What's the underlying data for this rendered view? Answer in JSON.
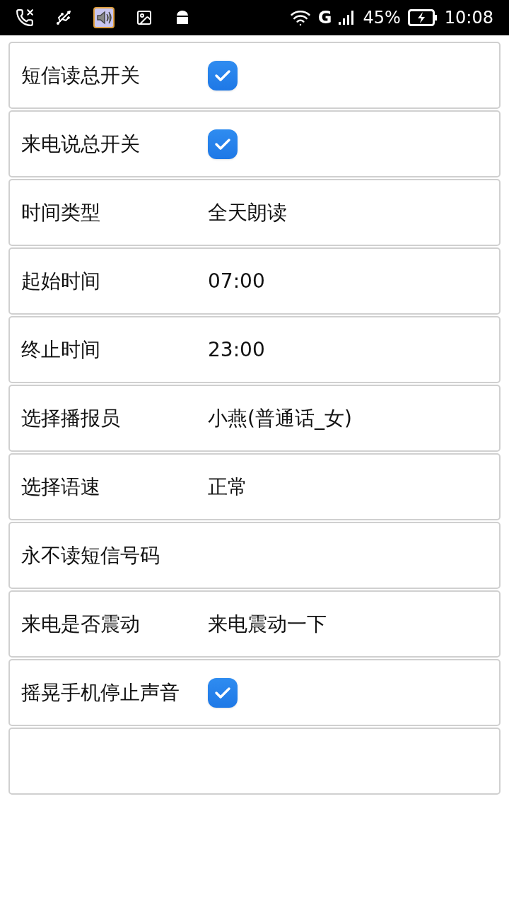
{
  "status_bar": {
    "network": "G",
    "battery": "45%",
    "time": "10:08"
  },
  "settings": [
    {
      "kind": "checkbox",
      "label": "短信读总开关",
      "checked": true
    },
    {
      "kind": "checkbox",
      "label": "来电说总开关",
      "checked": true
    },
    {
      "kind": "value",
      "label": "时间类型",
      "value": "全天朗读"
    },
    {
      "kind": "value",
      "label": "起始时间",
      "value": "07:00"
    },
    {
      "kind": "value",
      "label": "终止时间",
      "value": "23:00"
    },
    {
      "kind": "value",
      "label": "选择播报员",
      "value": "小燕(普通话_女)"
    },
    {
      "kind": "value",
      "label": "选择语速",
      "value": "正常"
    },
    {
      "kind": "link",
      "label": "永不读短信号码"
    },
    {
      "kind": "value",
      "label": "来电是否震动",
      "value": "来电震动一下"
    },
    {
      "kind": "checkbox",
      "label": "摇晃手机停止声音",
      "checked": true
    },
    {
      "kind": "blank"
    }
  ]
}
